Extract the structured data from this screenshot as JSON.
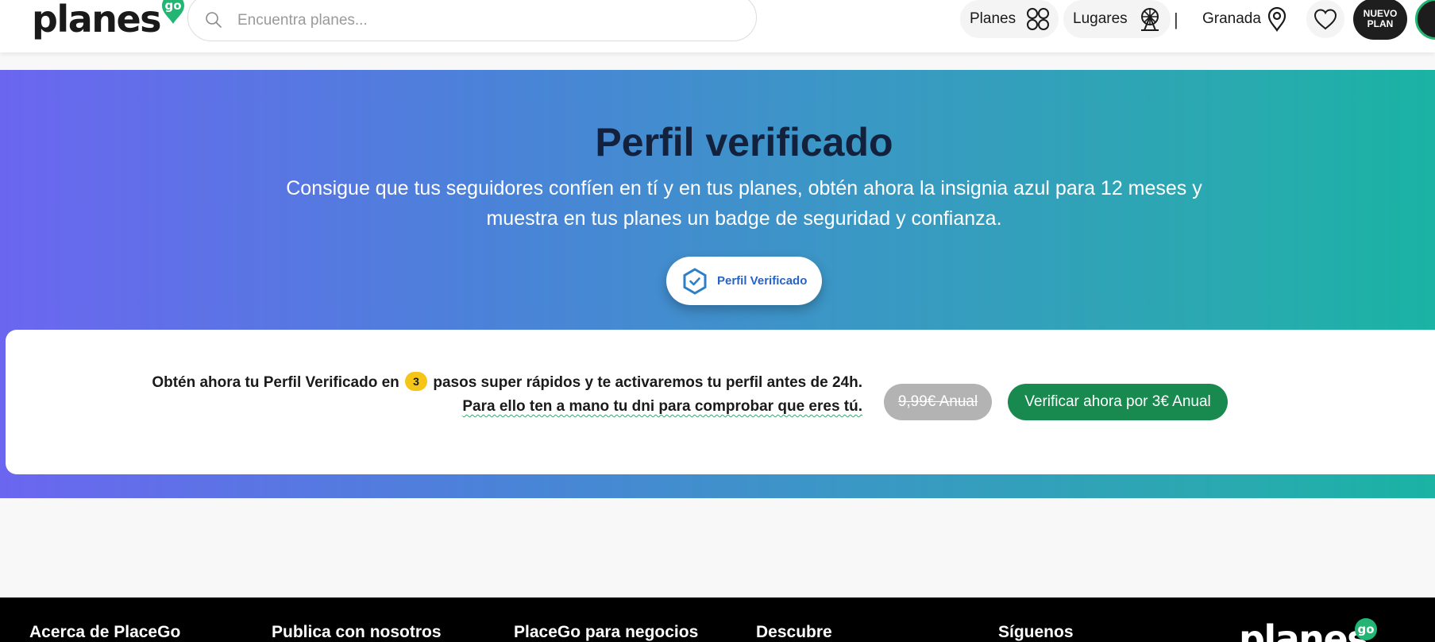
{
  "header": {
    "logo_text": "planes",
    "logo_badge": "go",
    "search_placeholder": "Encuentra planes...",
    "nav": {
      "planes_label": "Planes",
      "lugares_label": "Lugares",
      "separator": "|",
      "location_label": "Granada",
      "new_plan_line1": "NUEVO",
      "new_plan_line2": "PLAN"
    }
  },
  "hero": {
    "title": "Perfil verificado",
    "subtitle": "Consigue que tus seguidores confíen en tí y en tus planes, obtén ahora la insignia azul para 12 meses y muestra en tus planes un badge de seguridad y confianza.",
    "badge_label": "Perfil Verificado"
  },
  "offer": {
    "line1_before": "Obtén ahora tu Perfil Verificado en",
    "steps_count": "3",
    "line1_after": "pasos super rápidos y te activaremos tu perfil antes de 24h.",
    "line2": "Para ello ten a mano tu dni para comprobar que eres tú.",
    "old_price": "9,99€ Anual",
    "cta_label": "Verificar ahora por 3€ Anual"
  },
  "footer": {
    "columns": [
      "Acerca de PlaceGo",
      "Publica con nosotros",
      "PlaceGo para negocios",
      "Descubre",
      "Síguenos"
    ],
    "logo_text": "planes"
  },
  "colors": {
    "brand_green": "#22b573",
    "cta_green": "#188a4f",
    "verified_blue": "#2563c9",
    "step_yellow": "#f5c518",
    "title_navy": "#14213d"
  }
}
